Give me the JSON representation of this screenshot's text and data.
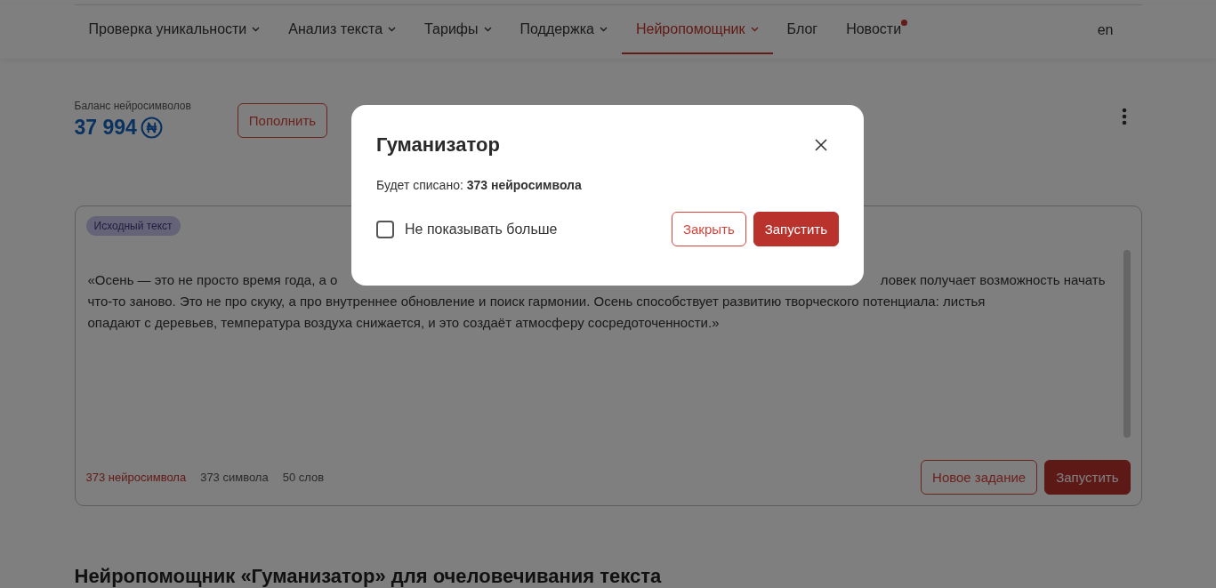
{
  "nav": {
    "items": [
      {
        "label": "Проверка уникальности",
        "dropdown": true,
        "selected": false,
        "dot": false
      },
      {
        "label": "Анализ текста",
        "dropdown": true,
        "selected": false,
        "dot": false
      },
      {
        "label": "Тарифы",
        "dropdown": true,
        "selected": false,
        "dot": false
      },
      {
        "label": "Поддержка",
        "dropdown": true,
        "selected": false,
        "dot": false
      },
      {
        "label": "Нейропомощник",
        "dropdown": true,
        "selected": true,
        "dot": false
      },
      {
        "label": "Блог",
        "dropdown": false,
        "selected": false,
        "dot": false
      },
      {
        "label": "Новости",
        "dropdown": false,
        "selected": false,
        "dot": true
      }
    ],
    "language": "en"
  },
  "balance": {
    "label": "Баланс нейросимволов",
    "value": "37 994",
    "button": "Пополнить"
  },
  "editor": {
    "tag": "Исходный текст",
    "lines": [
      [
        "«Осень — это не просто время года, а о",
        "ловек получает возможность начать"
      ],
      [
        "что-то заново. Это не про скуку, а про внутреннее обновление и поиск гармонии. Осень способствует развитию творческого потенциала: листья"
      ],
      [
        "опадают с деревьев, температура воздуха снижается, и это создаёт атмосферу сосредоточенности.»"
      ]
    ],
    "counts": [
      {
        "text": "373 нейросимвола",
        "highlight": true
      },
      {
        "text": "373 символа",
        "highlight": false
      },
      {
        "text": "50 слов",
        "highlight": false
      }
    ],
    "buttons": [
      {
        "label": "Новое задание",
        "kind": "outline"
      },
      {
        "label": "Запустить",
        "kind": "primary"
      }
    ]
  },
  "heading": "Нейропомощник «Гуманизатор» для очеловечивания текста",
  "dialog": {
    "title": "Гуманизатор",
    "message": "Будет списано: **373 нейросимвола**",
    "checkbox": {
      "label": "Не показывать больше",
      "checked": false
    },
    "buttons": [
      {
        "label": "Закрыть",
        "kind": "outline"
      },
      {
        "label": "Запустить",
        "kind": "primary"
      }
    ]
  }
}
